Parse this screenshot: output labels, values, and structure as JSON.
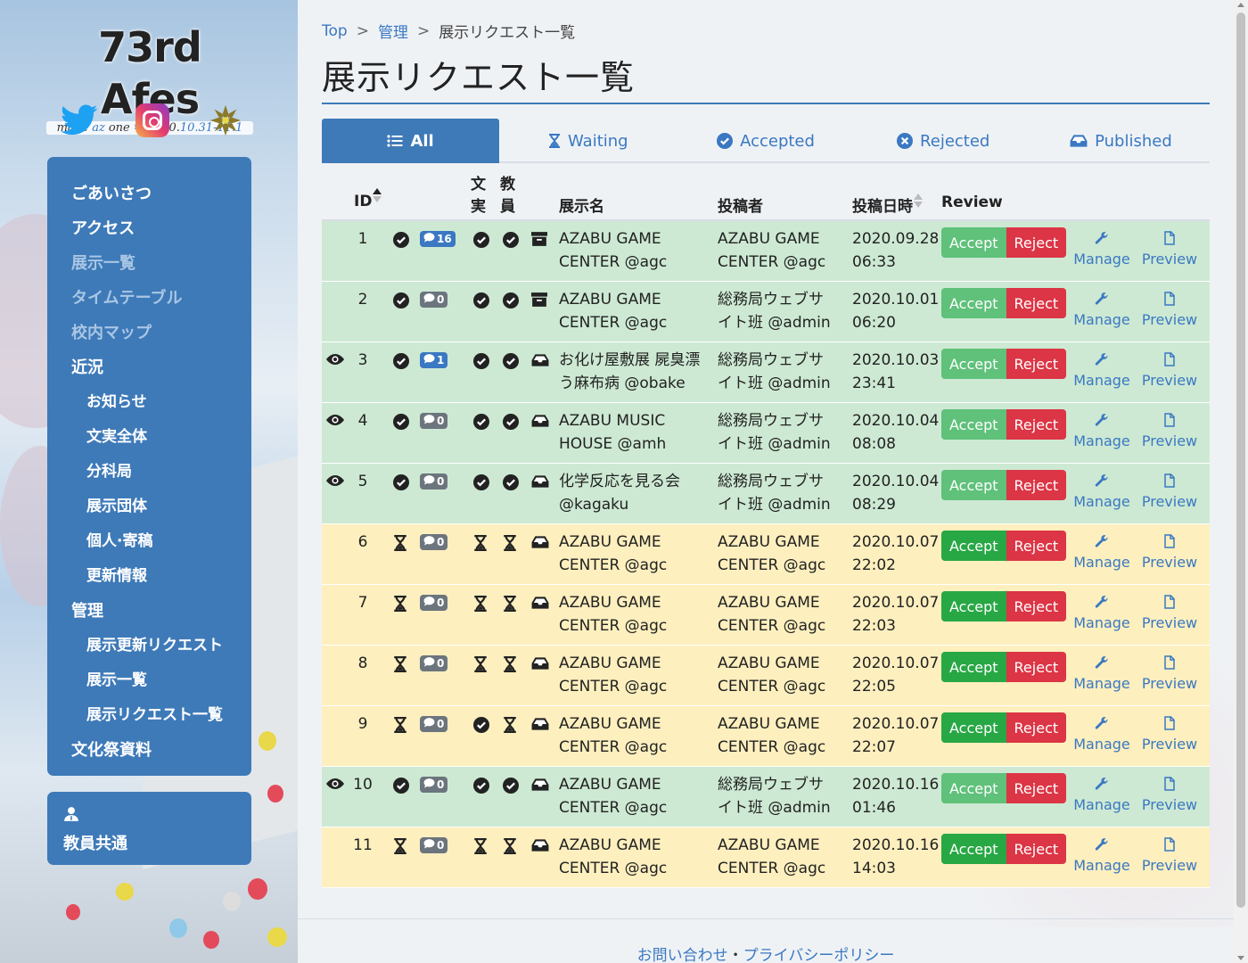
{
  "brand": {
    "title": "73rd Afes",
    "tagline_make": "make",
    "tagline_az": "az",
    "tagline_one": "one",
    "date_prefix": "2020.",
    "date_days": "10.31-11.1"
  },
  "social": [
    "twitter-icon",
    "instagram-icon",
    "school-emblem-icon"
  ],
  "nav": {
    "items": [
      {
        "label": "ごあいさつ",
        "style": "main"
      },
      {
        "label": "アクセス",
        "style": "main"
      },
      {
        "label": "展示一覧",
        "style": "dim"
      },
      {
        "label": "タイムテーブル",
        "style": "dim"
      },
      {
        "label": "校内マップ",
        "style": "dim"
      },
      {
        "label": "近況",
        "style": "main"
      },
      {
        "label": "お知らせ",
        "style": "sub"
      },
      {
        "label": "文実全体",
        "style": "sub"
      },
      {
        "label": "分科局",
        "style": "sub"
      },
      {
        "label": "展示団体",
        "style": "sub"
      },
      {
        "label": "個人·寄稿",
        "style": "sub"
      },
      {
        "label": "更新情報",
        "style": "sub"
      },
      {
        "label": "管理",
        "style": "main"
      },
      {
        "label": "展示更新リクエスト",
        "style": "sub"
      },
      {
        "label": "展示一覧",
        "style": "sub"
      },
      {
        "label": "展示リクエスト一覧",
        "style": "sub"
      },
      {
        "label": "文化祭資料",
        "style": "main"
      }
    ],
    "staff_label": "教員共通"
  },
  "breadcrumb": {
    "top": "Top",
    "sep": ">",
    "admin": "管理",
    "current": "展示リクエスト一覧"
  },
  "page_title": "展示リクエスト一覧",
  "tabs": [
    {
      "label": "All",
      "icon": "list-icon",
      "active": true
    },
    {
      "label": "Waiting",
      "icon": "hourglass-icon",
      "active": false
    },
    {
      "label": "Accepted",
      "icon": "check-circle-icon",
      "active": false
    },
    {
      "label": "Rejected",
      "icon": "x-circle-icon",
      "active": false
    },
    {
      "label": "Published",
      "icon": "inbox-icon",
      "active": false
    }
  ],
  "table": {
    "headers": {
      "id": "ID",
      "bun": "文",
      "jitsu": "実",
      "kyo": "教",
      "in": "員",
      "name": "展示名",
      "poster": "投稿者",
      "date": "投稿日時",
      "review": "Review"
    },
    "accept_label": "Accept",
    "reject_label": "Reject",
    "manage_label": "Manage",
    "preview_label": "Preview",
    "rows": [
      {
        "id": "1",
        "bg": "green",
        "eye": false,
        "status": "check",
        "comments": "16",
        "cm": "primary",
        "bun": "check",
        "kyo": "check",
        "pub": "archive",
        "name1": "AZABU GAME",
        "name2": "CENTER @agc",
        "poster1": "AZABU GAME",
        "poster2": "CENTER @agc",
        "date1": "2020.09.28",
        "date2": "06:33",
        "accept_faded": true
      },
      {
        "id": "2",
        "bg": "green",
        "eye": false,
        "status": "check",
        "comments": "0",
        "cm": "gray",
        "bun": "check",
        "kyo": "check",
        "pub": "archive",
        "name1": "AZABU GAME",
        "name2": "CENTER @agc",
        "poster1": "総務局ウェブサ",
        "poster2": "イト班 @admin",
        "date1": "2020.10.01",
        "date2": "06:20",
        "accept_faded": true
      },
      {
        "id": "3",
        "bg": "green",
        "eye": true,
        "status": "check",
        "comments": "1",
        "cm": "primary",
        "bun": "check",
        "kyo": "check",
        "pub": "inbox",
        "name1": "お化け屋敷展 屍臭漂",
        "name2": "う麻布病 @obake",
        "poster1": "総務局ウェブサ",
        "poster2": "イト班 @admin",
        "date1": "2020.10.03",
        "date2": "23:41",
        "accept_faded": true
      },
      {
        "id": "4",
        "bg": "green",
        "eye": true,
        "status": "check",
        "comments": "0",
        "cm": "gray",
        "bun": "check",
        "kyo": "check",
        "pub": "inbox",
        "name1": "AZABU MUSIC",
        "name2": "HOUSE @amh",
        "poster1": "総務局ウェブサ",
        "poster2": "イト班 @admin",
        "date1": "2020.10.04",
        "date2": "08:08",
        "accept_faded": true
      },
      {
        "id": "5",
        "bg": "green",
        "eye": true,
        "status": "check",
        "comments": "0",
        "cm": "gray",
        "bun": "check",
        "kyo": "check",
        "pub": "inbox",
        "name1": "化学反応を見る会",
        "name2": "@kagaku",
        "poster1": "総務局ウェブサ",
        "poster2": "イト班 @admin",
        "date1": "2020.10.04",
        "date2": "08:29",
        "accept_faded": true
      },
      {
        "id": "6",
        "bg": "yellow",
        "eye": false,
        "status": "hourglass",
        "comments": "0",
        "cm": "gray",
        "bun": "hourglass",
        "kyo": "hourglass",
        "pub": "inbox",
        "name1": "AZABU GAME",
        "name2": "CENTER @agc",
        "poster1": "AZABU GAME",
        "poster2": "CENTER @agc",
        "date1": "2020.10.07",
        "date2": "22:02",
        "accept_faded": false
      },
      {
        "id": "7",
        "bg": "yellow",
        "eye": false,
        "status": "hourglass",
        "comments": "0",
        "cm": "gray",
        "bun": "hourglass",
        "kyo": "hourglass",
        "pub": "inbox",
        "name1": "AZABU GAME",
        "name2": "CENTER @agc",
        "poster1": "AZABU GAME",
        "poster2": "CENTER @agc",
        "date1": "2020.10.07",
        "date2": "22:03",
        "accept_faded": false
      },
      {
        "id": "8",
        "bg": "yellow",
        "eye": false,
        "status": "hourglass",
        "comments": "0",
        "cm": "gray",
        "bun": "hourglass",
        "kyo": "hourglass",
        "pub": "inbox",
        "name1": "AZABU GAME",
        "name2": "CENTER @agc",
        "poster1": "AZABU GAME",
        "poster2": "CENTER @agc",
        "date1": "2020.10.07",
        "date2": "22:05",
        "accept_faded": false
      },
      {
        "id": "9",
        "bg": "yellow",
        "eye": false,
        "status": "hourglass",
        "comments": "0",
        "cm": "gray",
        "bun": "check",
        "kyo": "hourglass",
        "pub": "inbox",
        "name1": "AZABU GAME",
        "name2": "CENTER @agc",
        "poster1": "AZABU GAME",
        "poster2": "CENTER @agc",
        "date1": "2020.10.07",
        "date2": "22:07",
        "accept_faded": false
      },
      {
        "id": "10",
        "bg": "green",
        "eye": true,
        "status": "check",
        "comments": "0",
        "cm": "gray",
        "bun": "check",
        "kyo": "check",
        "pub": "inbox",
        "name1": "AZABU GAME",
        "name2": "CENTER @agc",
        "poster1": "総務局ウェブサ",
        "poster2": "イト班 @admin",
        "date1": "2020.10.16",
        "date2": "01:46",
        "accept_faded": true
      },
      {
        "id": "11",
        "bg": "yellow",
        "eye": false,
        "status": "hourglass",
        "comments": "0",
        "cm": "gray",
        "bun": "hourglass",
        "kyo": "hourglass",
        "pub": "inbox",
        "name1": "AZABU GAME",
        "name2": "CENTER @agc",
        "poster1": "AZABU GAME",
        "poster2": "CENTER @agc",
        "date1": "2020.10.16",
        "date2": "14:03",
        "accept_faded": false
      }
    ]
  },
  "footer": {
    "contact": "お問い合わせ",
    "dot": "・",
    "privacy": "プライバシーポリシー"
  },
  "colors": {
    "accent": "#3e7ab8",
    "link": "#3a78c2",
    "accept": "#28a745",
    "reject": "#dc3545",
    "row_green": "#cde9d3",
    "row_yellow": "#fdefbe"
  }
}
